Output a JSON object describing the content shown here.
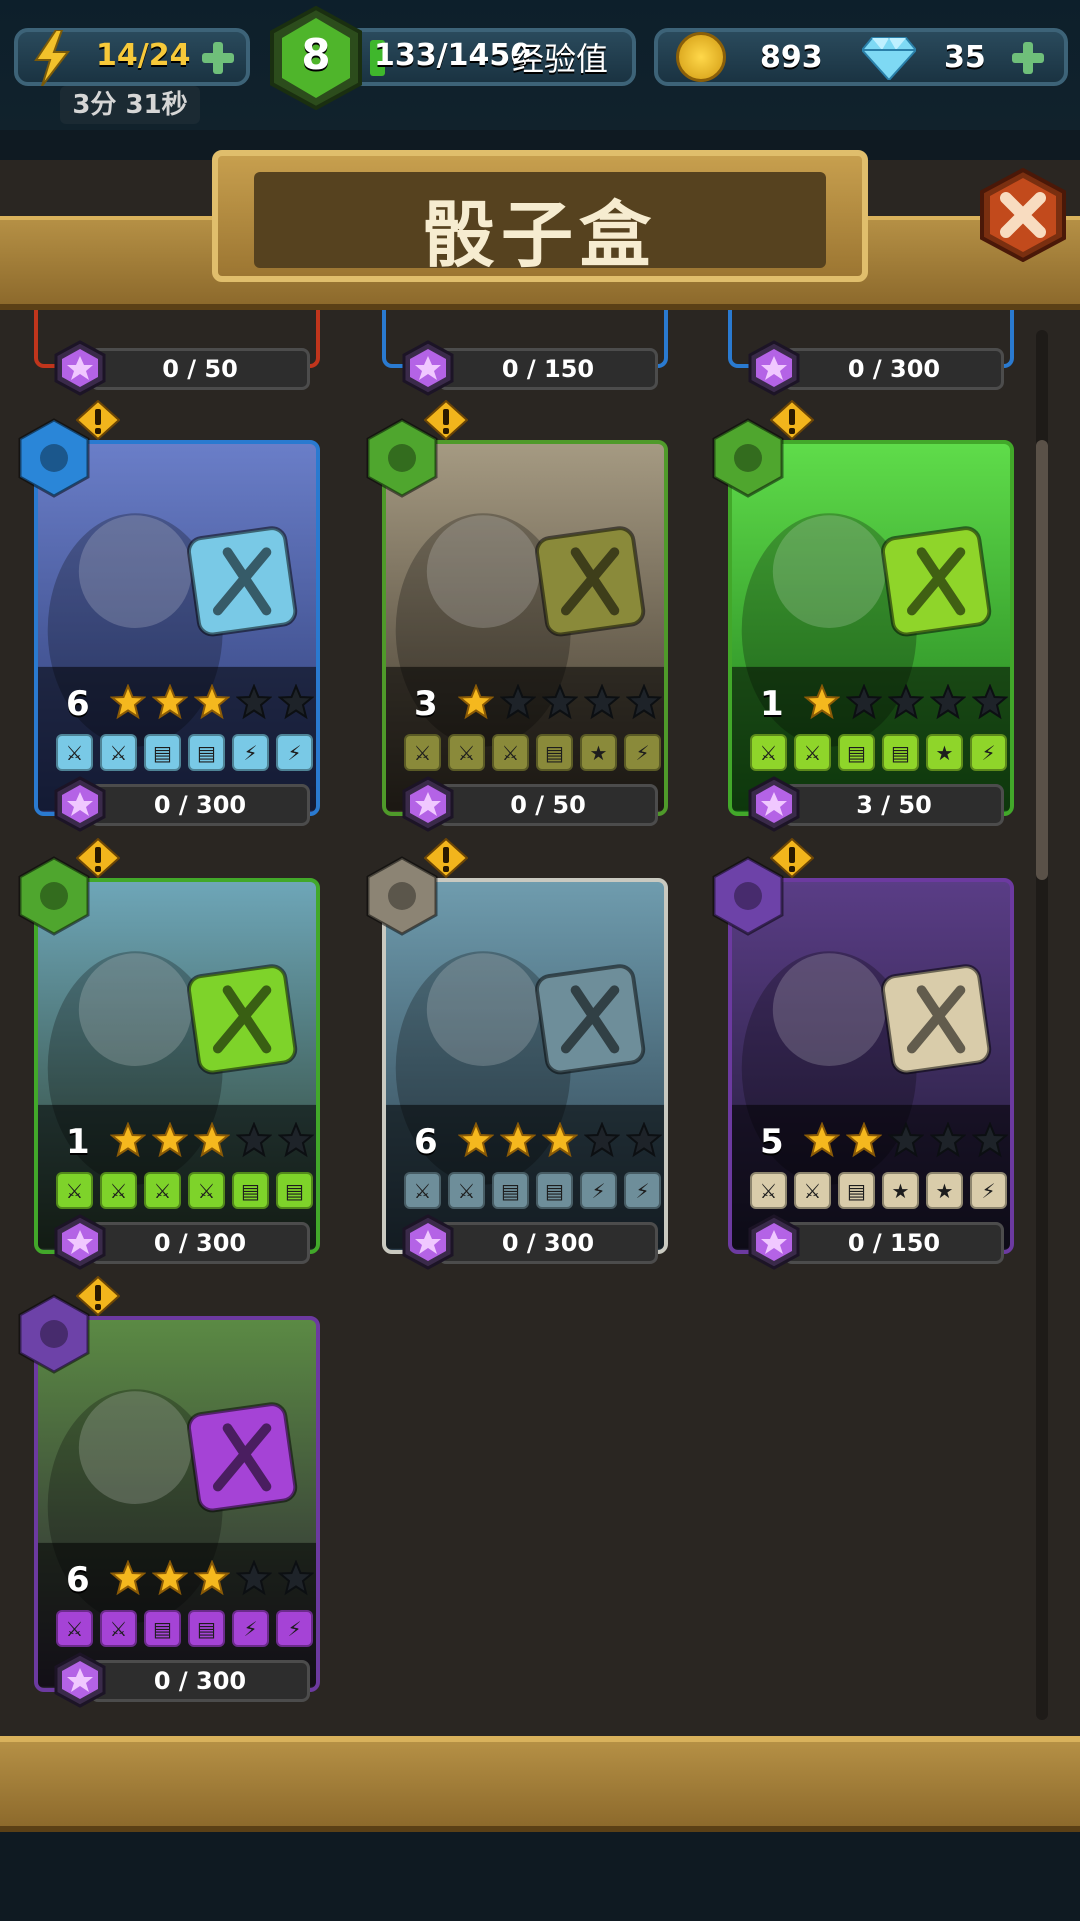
{
  "hud": {
    "energy": "14/24",
    "timer": "3分 31秒",
    "level": "8",
    "xp_text": "133/1450",
    "xp_label": "经验值",
    "xp_progress": 0.092,
    "gold": "893",
    "gems": "35"
  },
  "title": "骰子盒",
  "partial_cards": [
    {
      "progress": "0 / 50"
    },
    {
      "progress": "0 / 150"
    },
    {
      "progress": "0 / 300"
    }
  ],
  "cards": [
    {
      "element": "water",
      "level": "6",
      "stars": 3,
      "progress": "0 / 300",
      "faces": [
        "sword",
        "sword",
        "shield",
        "shield",
        "bolt",
        "bolt"
      ],
      "theme": "blue"
    },
    {
      "element": "leaf",
      "level": "3",
      "stars": 1,
      "progress": "0 / 50",
      "faces": [
        "sword",
        "sword",
        "sword",
        "shield",
        "star",
        "bolt"
      ],
      "theme": "olive"
    },
    {
      "element": "leaf",
      "level": "1",
      "stars": 1,
      "progress": "3 / 50",
      "faces": [
        "sword",
        "sword",
        "shield",
        "shield",
        "star",
        "bolt"
      ],
      "theme": "green"
    },
    {
      "element": "leaf",
      "level": "1",
      "stars": 3,
      "progress": "0 / 300",
      "faces": [
        "sword",
        "sword",
        "sword",
        "sword",
        "shield",
        "shield"
      ],
      "theme": "lime"
    },
    {
      "element": "wind",
      "level": "6",
      "stars": 3,
      "progress": "0 / 300",
      "faces": [
        "sword",
        "sword",
        "shield",
        "shield",
        "bolt",
        "bolt"
      ],
      "theme": "slate"
    },
    {
      "element": "arcane",
      "level": "5",
      "stars": 2,
      "progress": "0 / 150",
      "faces": [
        "sword",
        "sword",
        "shield",
        "star",
        "star",
        "bolt"
      ],
      "theme": "beige"
    },
    {
      "element": "arcane",
      "level": "6",
      "stars": 3,
      "progress": "0 / 300",
      "faces": [
        "sword",
        "sword",
        "shield",
        "shield",
        "bolt",
        "bolt"
      ],
      "theme": "purple"
    }
  ]
}
